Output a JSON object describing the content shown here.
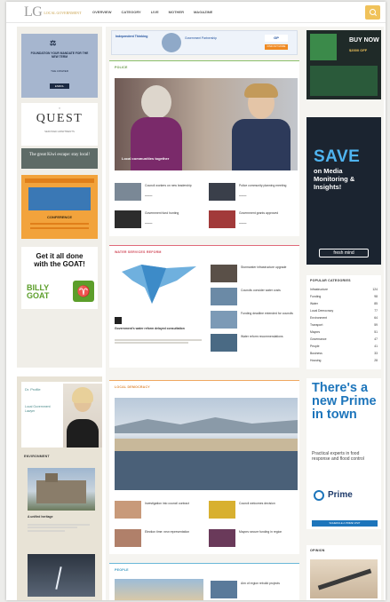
{
  "site": {
    "logo": "LG",
    "logo_tag": "LOCAL GOVERNMENT",
    "nav": [
      "OVERVIEW",
      "CATEGORY",
      "LIVE",
      "MOTHER",
      "MAGAZINE"
    ]
  },
  "left": {
    "ad1": {
      "title": "FOUNDATION YOUR MANDATE FOR THE NEW TERM",
      "sub": "THE ANSWER",
      "badge": "ENROL"
    },
    "quest": {
      "name": "QUEST",
      "tag": "SERVICED APARTMENTS",
      "banner": "The great Kiwi escape: stay local!"
    },
    "ad3": {
      "title": "CONFERENCE"
    },
    "goat": {
      "line1": "Get it all done",
      "line2": "with the GOAT!",
      "brand": "BILLY GOAT"
    },
    "profile": {
      "brand": "Dr. Profile",
      "caption": "Local Government Lawyer"
    },
    "environment": {
      "label": "ENVIRONMENT",
      "story": "A unified heritage"
    }
  },
  "center": {
    "top_banner": {
      "left": "Independent Thinking",
      "right": "Government Partnership",
      "btn": "FIND OUT MORE"
    },
    "section1": {
      "label": "POLICE",
      "lead": "Local communities together",
      "items": [
        "Council workers on new leadership",
        "Police community planning meeting",
        "Government fund hunting",
        "Government grants approved"
      ]
    },
    "section2": {
      "label": "WATER SERVICES REFORM",
      "lead": "Government's water reform delayed consultation",
      "items": [
        "Stormwater infrastructure upgrade",
        "Councils consider water costs",
        "Funding deadline extended for councils",
        "Water reform recommendations"
      ]
    },
    "section3": {
      "label": "LOCAL DEMOCRACY",
      "items": [
        "Investigation into council contract",
        "Council welcomes decision",
        "Election time: new representation",
        "Mayors secure funding in region"
      ]
    },
    "section4": {
      "label": "PEOPLE",
      "items": [
        "Aim of region rebuild projects"
      ]
    }
  },
  "right": {
    "save": {
      "line1": "SAVE",
      "line2": "on Media Monitoring & Insights!",
      "brand": "fresh mind"
    },
    "categories": {
      "label": "POPULAR CATEGORIES",
      "items": [
        {
          "name": "Infrastructure",
          "count": "124"
        },
        {
          "name": "Funding",
          "count": "98"
        },
        {
          "name": "Water",
          "count": "85"
        },
        {
          "name": "Local Democracy",
          "count": "77"
        },
        {
          "name": "Environment",
          "count": "64"
        },
        {
          "name": "Transport",
          "count": "59"
        },
        {
          "name": "Mayors",
          "count": "51"
        },
        {
          "name": "Governance",
          "count": "47"
        },
        {
          "name": "People",
          "count": "41"
        },
        {
          "name": "Business",
          "count": "33"
        },
        {
          "name": "Housing",
          "count": "28"
        }
      ]
    },
    "prime": {
      "headline": "There's a new Prime in town",
      "body": "Practical experts in food response and flood control",
      "brand": "Prime",
      "btn": "SCHEDULE A PRIME VISIT"
    },
    "ad_top": {
      "line1": "BUY NOW",
      "line2": "$2000 OFF"
    },
    "last": {
      "label": "OPINION"
    }
  },
  "colors": {
    "accent": "#f0c25a",
    "prime_blue": "#1d75bb",
    "save_bg": "#1b2430",
    "goat_green": "#5c9e2a"
  }
}
